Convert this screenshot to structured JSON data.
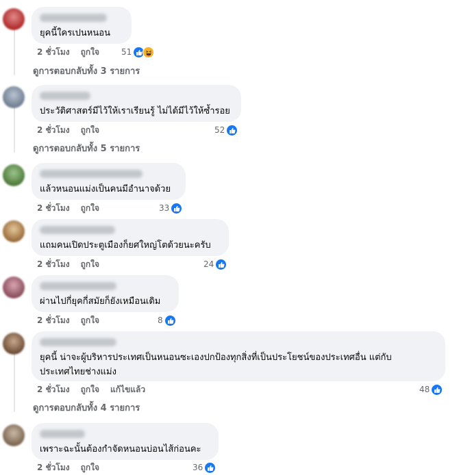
{
  "comments": [
    {
      "text": "ยุคนี้ใครเปนหนอน",
      "time": "2 ชั่วโมง",
      "like": "ถูกใจ",
      "reactions": "51",
      "replies": "ดูการตอบกลับทั้ง 3 รายการ"
    },
    {
      "text": "ประวัติศาสตร์มีไว้ให้เราเรียนรู้ ไม่ได้มีไว้ให้ซ้ำรอย",
      "time": "2 ชั่วโมง",
      "like": "ถูกใจ",
      "reactions": "52",
      "replies": "ดูการตอบกลับทั้ง 5 รายการ"
    },
    {
      "text": "แล้วหนอนแม่งเป็นคนมีอำนาจด้วย",
      "time": "2 ชั่วโมง",
      "like": "ถูกใจ",
      "reactions": "33"
    },
    {
      "text": "แถมคนเปิดประตูเมืองก็ยศใหญ่โตด้วยนะครับ",
      "time": "2 ชั่วโมง",
      "like": "ถูกใจ",
      "reactions": "24"
    },
    {
      "text": "ผ่านไปกี่ยุคกี่สมัยก็ยังเหมือนเดิม",
      "time": "2 ชั่วโมง",
      "like": "ถูกใจ",
      "reactions": "8"
    },
    {
      "text_line1": "ยุคนี้ น่าจะผู้บริหารประเทศเป็นหนอนซะเองปกป้องทุกสิ่งที่เป็นประโยชน์ของประเทศอื่น แต่กับ",
      "text_line2": "ประเทศไทยช่างแม่ง",
      "time": "2 ชั่วโมง",
      "like": "ถูกใจ",
      "edited": "แก้ไขแล้ว",
      "reactions": "48",
      "replies": "ดูการตอบกลับทั้ง 4 รายการ"
    },
    {
      "text": "เพราะฉะนั้นต้องกำจัดหนอนบ่อนไส้ก่อนคะ",
      "time": "2 ชั่วโมง",
      "like": "ถูกใจ",
      "reactions": "36"
    }
  ],
  "colors": {
    "bubble": "#f0f2f5",
    "like_blue": "#1877f2",
    "meta_gray": "#65676b",
    "haha_yellow": "#f7b125"
  },
  "icons": {
    "like": "thumbs-up-icon",
    "haha": "haha-face-icon"
  }
}
